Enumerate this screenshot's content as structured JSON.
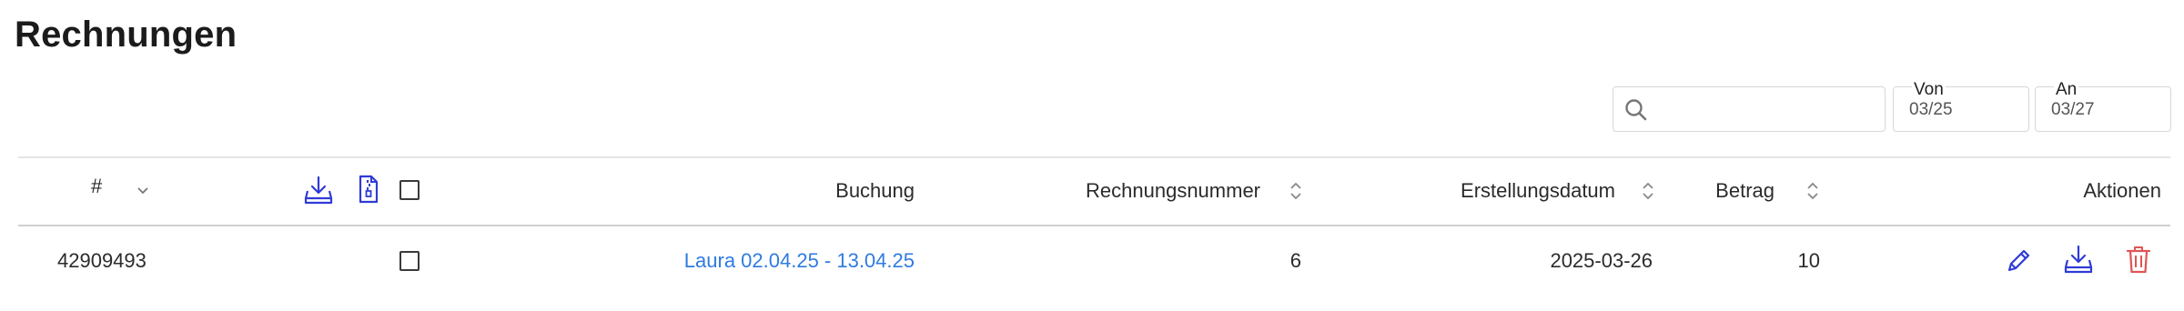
{
  "page": {
    "title": "Rechnungen"
  },
  "filters": {
    "search_placeholder": "",
    "from_label": "Von",
    "from_value": "03/25",
    "to_label": "An",
    "to_value": "03/27"
  },
  "table": {
    "headers": {
      "id": "#",
      "booking": "Buchung",
      "invoice_number": "Rechnungsnummer",
      "created_date": "Erstellungsdatum",
      "amount": "Betrag",
      "actions": "Aktionen"
    },
    "rows": [
      {
        "id": "42909493",
        "booking": "Laura 02.04.25 - 13.04.25",
        "invoice_number": "6",
        "created_date": "2025-03-26",
        "amount": "10"
      }
    ]
  },
  "colors": {
    "accent": "#2f3bd6",
    "link": "#2f7be0",
    "danger": "#e05555"
  },
  "icons": [
    "search-icon",
    "download-icon",
    "zip-file-icon",
    "sort-icon",
    "edit-icon",
    "delete-icon"
  ]
}
